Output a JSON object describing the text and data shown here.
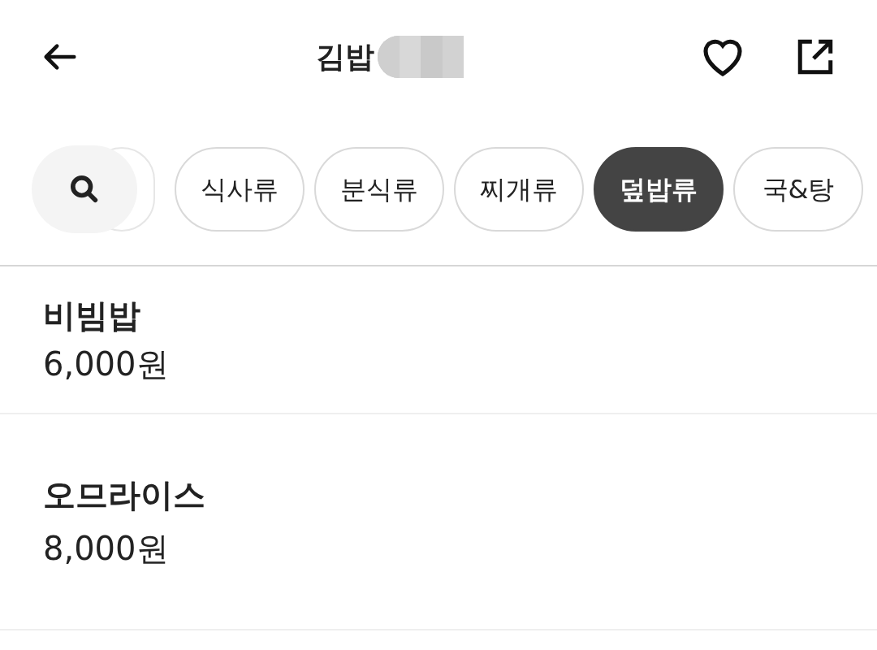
{
  "header": {
    "title": "김밥"
  },
  "categories": [
    {
      "label": "식사류",
      "selected": false
    },
    {
      "label": "분식류",
      "selected": false
    },
    {
      "label": "찌개류",
      "selected": false
    },
    {
      "label": "덮밥류",
      "selected": true
    },
    {
      "label": "국&탕",
      "selected": false
    }
  ],
  "menu_items": [
    {
      "name": "비빔밥",
      "price": "6,000원"
    },
    {
      "name": "오므라이스",
      "price": "8,000원"
    }
  ]
}
